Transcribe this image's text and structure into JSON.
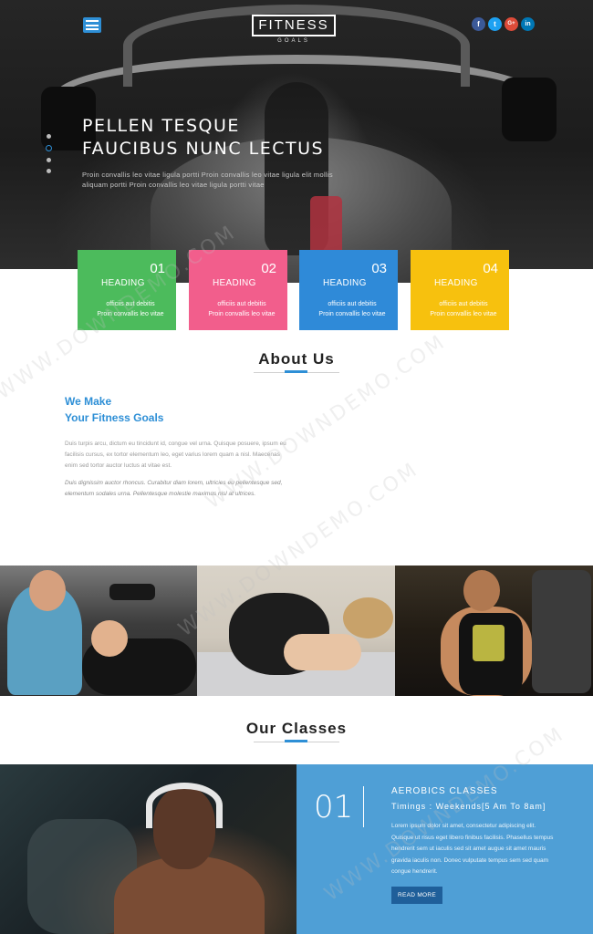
{
  "header": {
    "logo": "FITNESS",
    "logo_sub": "GOALS",
    "social": [
      {
        "icon": "facebook-icon",
        "glyph": "f",
        "color": "#3b5998"
      },
      {
        "icon": "twitter-icon",
        "glyph": "t",
        "color": "#1da1f2"
      },
      {
        "icon": "google-plus-icon",
        "glyph": "G+",
        "color": "#dd4b39"
      },
      {
        "icon": "linkedin-icon",
        "glyph": "in",
        "color": "#0077b5"
      }
    ]
  },
  "hero": {
    "title_line1": "PELLEN TESQUE",
    "title_line2": "FAUCIBUS NUNC LECTUS",
    "text": "Proin convallis leo vitae ligula portti Proin convallis leo vitae ligula elit mollis aliquam portti Proin convallis leo vitae ligula portti vitae"
  },
  "features": [
    {
      "num": "01",
      "heading": "HEADING",
      "line1": "officiis aut debitis",
      "line2": "Proin convallis leo vitae",
      "color": "#4cbb5c"
    },
    {
      "num": "02",
      "heading": "HEADING",
      "line1": "officiis aut debitis",
      "line2": "Proin convallis leo vitae",
      "color": "#f25e8c"
    },
    {
      "num": "03",
      "heading": "HEADING",
      "line1": "officiis aut debitis",
      "line2": "Proin convallis leo vitae",
      "color": "#2f8ad8"
    },
    {
      "num": "04",
      "heading": "HEADING",
      "line1": "officiis aut debitis",
      "line2": "Proin convallis leo vitae",
      "color": "#f7c10e"
    }
  ],
  "about": {
    "title": "About Us",
    "heading_line1": "We Make",
    "heading_line2": "Your Fitness Goals",
    "p1": "Duis turpis arcu, dictum eu tincidunt id, congue vel urna. Quisque posuere, ipsum eu facilisis cursus, ex tortor elementum leo, eget varius lorem quam a nisl. Maecenas enim sed tortor auctor luctus at vitae est.",
    "p2": "Duis dignissim auctor rhoncus. Curabitur diam lorem, ultricies eu pellentesque sed, elementum sodales urna. Pellentesque molestie maximus nisl at ultrices."
  },
  "classes": {
    "title": "Our Classes",
    "num": "01",
    "name": "AEROBICS CLASSES",
    "timing": "Timings : Weekends[5 Am To 8am]",
    "desc": "Lorem ipsum dolor sit amet, consectetur adipiscing elit. Quisque ut risus eget libero finibus facilisis. Phasellus tempus hendrerit sem ut iaculis sed sit amet augue sit amet mauris gravida iaculis non. Donec vulputate tempus sem sed quam congue hendrerit.",
    "button": "READ MORE"
  },
  "watermark": "WWW.DOWNDEMO.COM",
  "accent": "#2e8fd6"
}
